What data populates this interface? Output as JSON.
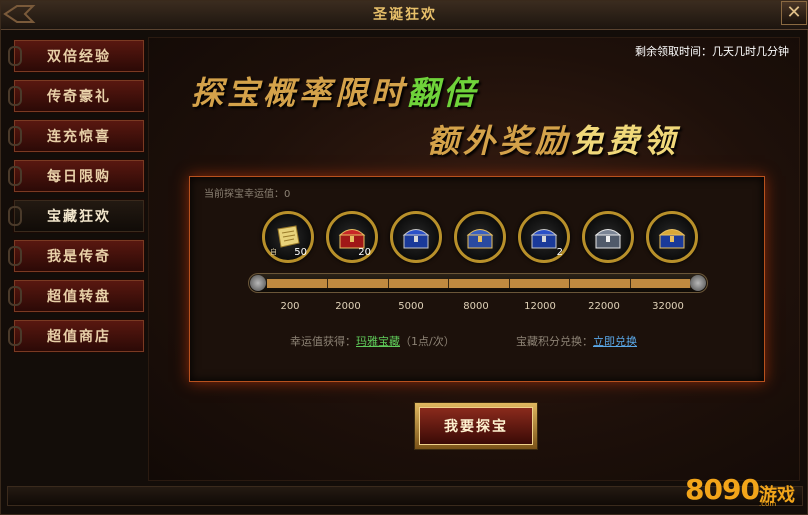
{
  "window": {
    "title": "圣诞狂欢",
    "close_label": "✕"
  },
  "sidebar": {
    "items": [
      {
        "label": "双倍经验"
      },
      {
        "label": "传奇豪礼"
      },
      {
        "label": "连充惊喜"
      },
      {
        "label": "每日限购"
      },
      {
        "label": "宝藏狂欢"
      },
      {
        "label": "我是传奇"
      },
      {
        "label": "超值转盘"
      },
      {
        "label": "超值商店"
      }
    ],
    "active_index": 4
  },
  "main": {
    "countdown": "剩余领取时间：几天几时几分钟",
    "banner_line1": {
      "text": "探宝概率限时",
      "highlight": "翻倍"
    },
    "banner_line2": {
      "text": "额外奖励",
      "highlight": "免费领"
    },
    "luck_label": "当前探宝幸运值：0",
    "rewards": [
      {
        "icon": "scroll-icon",
        "count": "50",
        "bound": "自"
      },
      {
        "icon": "red-chest-icon",
        "count": "20"
      },
      {
        "icon": "blue-chest-icon",
        "count": ""
      },
      {
        "icon": "gold-chest-icon",
        "count": ""
      },
      {
        "icon": "blue-chest-icon",
        "count": "2"
      },
      {
        "icon": "silver-chest-icon",
        "count": ""
      },
      {
        "icon": "gold-chest-icon",
        "count": ""
      }
    ],
    "progress": {
      "current": 0,
      "fraction": 0.0
    },
    "thresholds": [
      "200",
      "2000",
      "5000",
      "8000",
      "12000",
      "22000",
      "32000"
    ],
    "gain": {
      "prefix": "幸运值获得：",
      "link": "玛雅宝藏",
      "suffix": "（1点/次）"
    },
    "redeem": {
      "prefix": "宝藏积分兑换：",
      "link": "立即兑换"
    },
    "explore_label": "我要探宝"
  },
  "logo": {
    "number": "8090",
    "text": "游戏",
    "sub": ".com"
  },
  "colors": {
    "accent_gold": "#d4a24a",
    "highlight_green": "#6fd33a",
    "link_green": "#5fcc5a",
    "link_blue": "#5aa8e8",
    "panel_border": "#b8521e"
  }
}
